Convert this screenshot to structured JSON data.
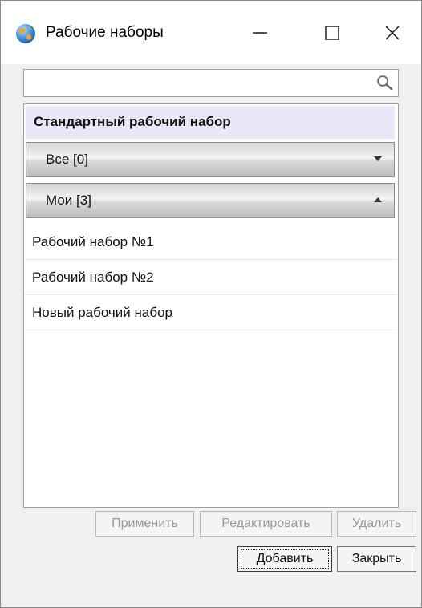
{
  "window": {
    "title": "Рабочие наборы",
    "icon": "globe-icon",
    "controls": {
      "minimize": "—",
      "maximize": "☐",
      "close": "✕"
    }
  },
  "search": {
    "value": "",
    "placeholder": "",
    "icon": "search-icon"
  },
  "panel": {
    "header": "Стандартный рабочий набор",
    "groups": [
      {
        "label": "Все [0]",
        "icon": "chevron-down-icon",
        "expanded": false
      },
      {
        "label": "Мои [3]",
        "icon": "chevron-up-icon",
        "expanded": true
      }
    ],
    "items": [
      "Рабочий набор №1",
      "Рабочий набор №2",
      "Новый рабочий набор"
    ]
  },
  "buttons": {
    "apply": "Применить",
    "edit": "Редактировать",
    "delete": "Удалить",
    "add": "Добавить",
    "close": "Закрыть"
  }
}
